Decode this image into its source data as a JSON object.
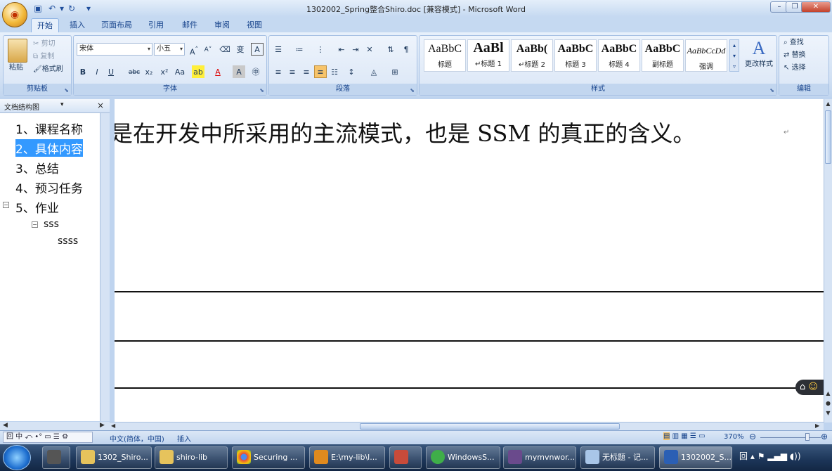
{
  "window": {
    "title": "1302002_Spring整合Shiro.doc [兼容模式] - Microsoft Word"
  },
  "tabs": [
    "开始",
    "插入",
    "页面布局",
    "引用",
    "邮件",
    "审阅",
    "视图"
  ],
  "clipboard": {
    "paste": "粘贴",
    "cut": "剪切",
    "copy": "复制",
    "format_painter": "格式刷",
    "label": "剪贴板"
  },
  "font": {
    "name": "宋体",
    "size": "小五",
    "label": "字体",
    "buttons": [
      "B",
      "I",
      "U",
      "abc",
      "x₂",
      "x²",
      "Aa",
      "A"
    ]
  },
  "paragraph": {
    "label": "段落"
  },
  "styles": {
    "items": [
      {
        "preview": "AaBbC",
        "name": "标题"
      },
      {
        "preview": "AaBl",
        "name": "↵标题 1"
      },
      {
        "preview": "AaBb(",
        "name": "↵标题 2"
      },
      {
        "preview": "AaBbC",
        "name": "标题 3"
      },
      {
        "preview": "AaBbC",
        "name": "标题 4"
      },
      {
        "preview": "AaBbC",
        "name": "副标题"
      },
      {
        "preview": "AaBbCcDd",
        "name": "强调"
      }
    ],
    "change": "更改样式",
    "label": "样式"
  },
  "editing": {
    "find": "查找",
    "replace": "替换",
    "select": "选择",
    "label": "编辑"
  },
  "docmap": {
    "title": "文档结构图",
    "items": [
      {
        "text": "1、课程名称"
      },
      {
        "text": "2、具体内容",
        "selected": true
      },
      {
        "text": "3、总结"
      },
      {
        "text": "4、预习任务"
      },
      {
        "text": "5、作业"
      },
      {
        "text": "sss"
      },
      {
        "text": "ssss"
      }
    ]
  },
  "document": {
    "line": "是在开发中所采用的主流模式，也是 SSM 的真正的含义。"
  },
  "status": {
    "language": "中文(简体，中国)",
    "mode": "插入",
    "zoom": "370%"
  },
  "taskbar": {
    "items": [
      "1302_Shiro...",
      "shiro-lib",
      "Securing ...",
      "E:\\my-lib\\l...",
      "",
      "WindowsS...",
      "mymvnwor...",
      "无标题 - 记...",
      "1302002_S..."
    ]
  }
}
